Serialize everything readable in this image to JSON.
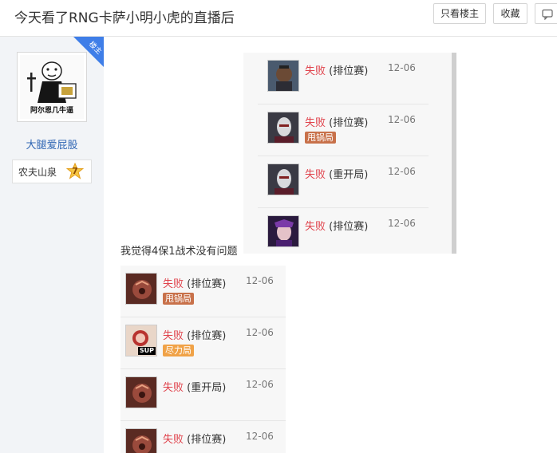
{
  "header": {
    "title": "今天看了RNG卡萨小明小虎的直播后",
    "only_op_label": "只看楼主",
    "favorite_label": "收藏",
    "reply_icon": "speech-bubble-icon"
  },
  "author": {
    "badge_ribbon": "楼主",
    "avatar_caption": "阿尔恩几牛逼",
    "username": "大腿爱屁股",
    "forum_badge_name": "农夫山泉",
    "level": "7"
  },
  "comment_text": "我觉得4保1战术没有问题",
  "match_list_1": [
    {
      "champion": "lucian-portrait",
      "result": "失败",
      "mode": "(排位赛)",
      "date": "12-06",
      "tag": ""
    },
    {
      "champion": "jhin-portrait",
      "result": "失败",
      "mode": "(排位赛)",
      "date": "12-06",
      "tag": "甩锅局",
      "tag_type": "gua"
    },
    {
      "champion": "jhin-portrait",
      "result": "失败",
      "mode": "(重开局)",
      "date": "12-06",
      "tag": ""
    },
    {
      "champion": "syndra-portrait",
      "result": "失败",
      "mode": "(排位赛)",
      "date": "12-06",
      "tag": ""
    }
  ],
  "match_list_2": [
    {
      "champion": "aatrox-portrait",
      "result": "失败",
      "mode": "(排位赛)",
      "date": "12-06",
      "tag": "甩锅局",
      "tag_type": "gua"
    },
    {
      "champion": "support-portrait",
      "result": "失败",
      "mode": "(排位赛)",
      "date": "12-06",
      "tag": "尽力局",
      "tag_type": "jin",
      "overlay": "SUP"
    },
    {
      "champion": "aatrox-portrait",
      "result": "失败",
      "mode": "(重开局)",
      "date": "12-06",
      "tag": ""
    },
    {
      "champion": "aatrox-portrait",
      "result": "失败",
      "mode": "(排位赛)",
      "date": "12-06",
      "tag": ""
    }
  ],
  "colors": {
    "loss": "#e0434c",
    "tag_blame": "#c8714a",
    "tag_tried": "#f0a247",
    "link": "#2d64b3",
    "ribbon": "#3f7ee8"
  }
}
